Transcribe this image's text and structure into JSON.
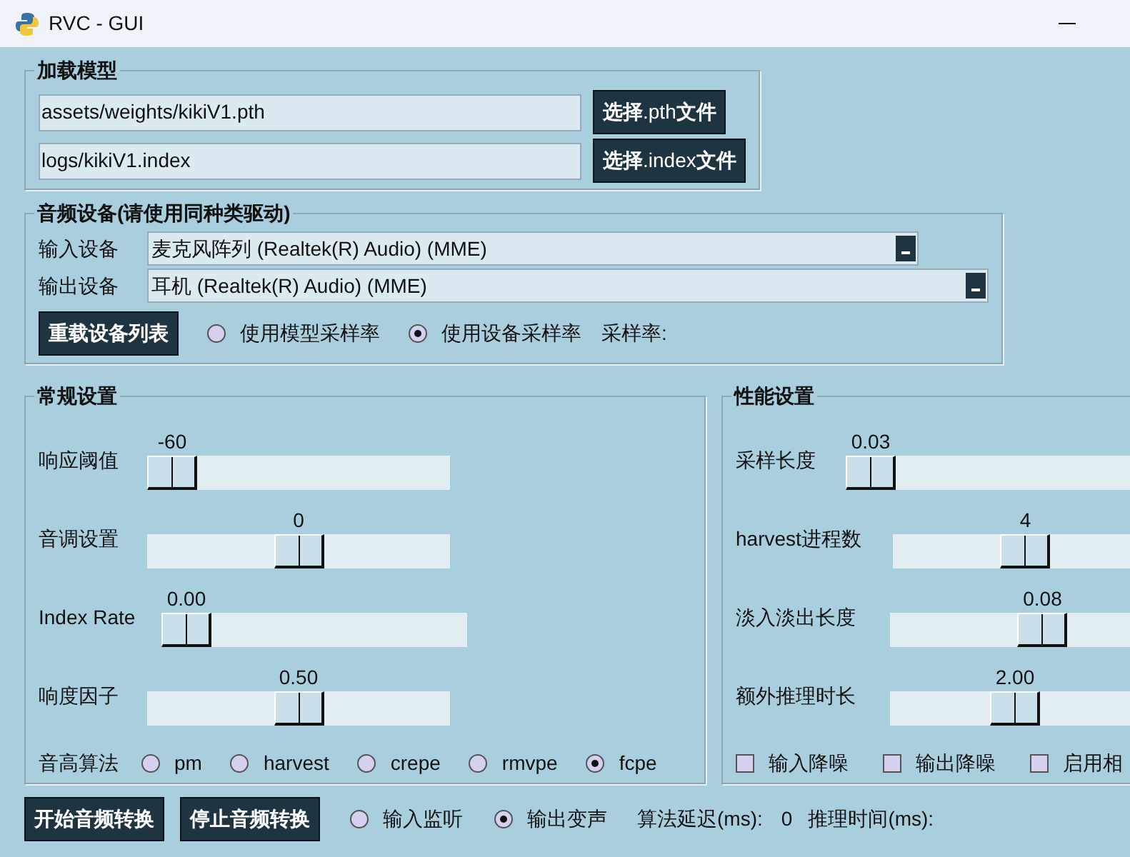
{
  "window": {
    "title": "RVC - GUI"
  },
  "load_model": {
    "title": "加载模型",
    "fields": [
      {
        "value": "assets/weights/kikiV1.pth",
        "button": "**选择**.pth**文件**"
      },
      {
        "value": "logs/kikiV1.index",
        "button": "**选择**.index**文件**"
      }
    ]
  },
  "audio_devices": {
    "title": "音频设备(请使用同种类驱动)",
    "selects": [
      {
        "label": "输入设备",
        "value": "麦克风阵列 (Realtek(R) Audio) (MME)"
      },
      {
        "label": "输出设备",
        "value": "耳机 (Realtek(R) Audio) (MME)"
      }
    ],
    "reload_button": "重载设备列表",
    "sample_rate_options": [
      {
        "label": "使用模型采样率",
        "selected": false
      },
      {
        "label": "使用设备采样率",
        "selected": true
      }
    ],
    "sample_rate_label": "采样率:"
  },
  "general": {
    "title": "常规设置",
    "sliders": [
      {
        "label": "响应阈值",
        "reading": "-60",
        "level": 0
      },
      {
        "label": "音调设置",
        "reading": "0",
        "level": 0.5
      },
      {
        "label": "Index Rate",
        "reading": "0.00",
        "level": 0
      },
      {
        "label": "响度因子",
        "reading": "0.50",
        "level": 0.5
      }
    ],
    "pitch_algorithm": {
      "label": "音高算法",
      "options": [
        {
          "label": "pm",
          "selected": false
        },
        {
          "label": "harvest",
          "selected": false
        },
        {
          "label": "crepe",
          "selected": false
        },
        {
          "label": "rmvpe",
          "selected": false
        },
        {
          "label": "fcpe",
          "selected": true
        }
      ]
    }
  },
  "performance": {
    "title": "性能设置",
    "sliders": [
      {
        "label": "采样长度",
        "reading": "0.03",
        "level": 0
      },
      {
        "label": "harvest进程数",
        "reading": "4",
        "level": 0.43
      },
      {
        "label": "淡入淡出长度",
        "reading": "0.08",
        "level": 0.51
      },
      {
        "label": "额外推理时长",
        "reading": "2.00",
        "level": 0.4
      }
    ],
    "checkboxes": [
      {
        "label": "输入降噪",
        "checked": false
      },
      {
        "label": "输出降噪",
        "checked": false
      },
      {
        "label": "启用相",
        "checked": false
      }
    ]
  },
  "bottom": {
    "buttons": [
      "开始音频转换",
      "停止音频转换"
    ],
    "monitor_options": [
      {
        "label": "输入监听",
        "selected": false
      },
      {
        "label": "输出变声",
        "selected": true
      }
    ],
    "latency_label": "算法延迟(ms):",
    "latency_value": "0",
    "inference_label": "推理时间(ms):"
  }
}
